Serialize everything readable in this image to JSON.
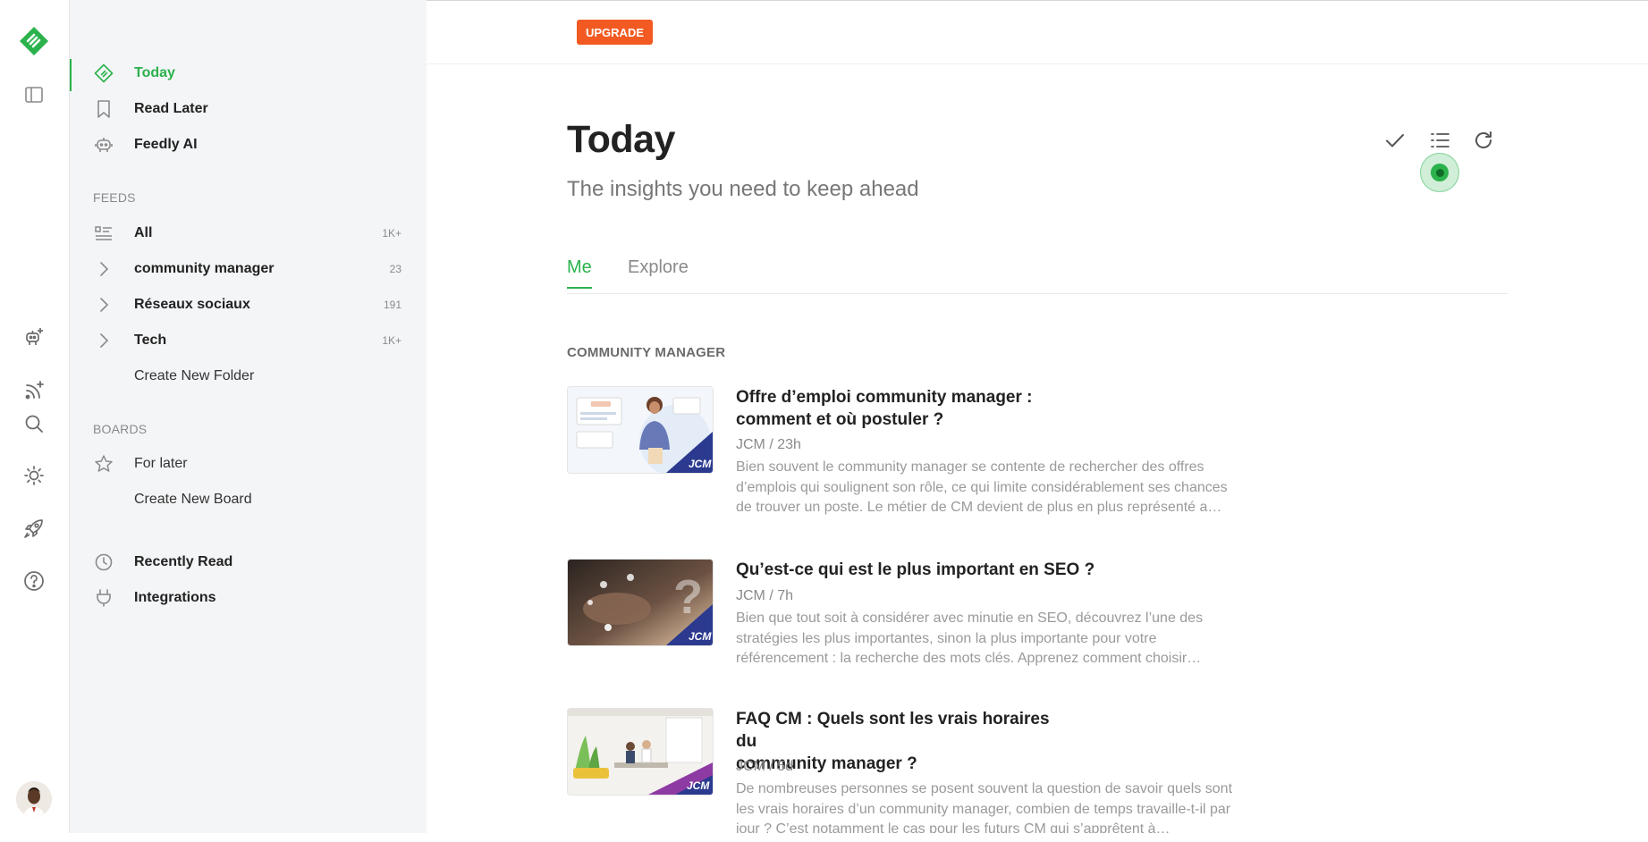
{
  "top_bar": {
    "upgrade_label": "UPGRADE"
  },
  "rail": {
    "icons": [
      "feedly-logo",
      "sidebar-toggle-icon",
      "add-ai-feed-icon",
      "add-rss-feed-icon",
      "search-icon",
      "theme-sun-icon",
      "rocket-icon",
      "help-icon",
      "user-avatar"
    ]
  },
  "sidebar": {
    "primary": [
      {
        "label": "Today",
        "icon": "today-icon",
        "active": true
      },
      {
        "label": "Read Later",
        "icon": "bookmark-icon"
      },
      {
        "label": "Feedly AI",
        "icon": "robot-icon"
      }
    ],
    "feeds_title": "FEEDS",
    "feeds": [
      {
        "label": "All",
        "count": "1K+",
        "icon": "list-icon"
      },
      {
        "label": "community manager",
        "count": "23",
        "icon": "chevron-right-icon"
      },
      {
        "label": "Réseaux sociaux",
        "count": "191",
        "icon": "chevron-right-icon"
      },
      {
        "label": "Tech",
        "count": "1K+",
        "icon": "chevron-right-icon"
      }
    ],
    "create_folder": "Create New Folder",
    "boards_title": "BOARDS",
    "boards": [
      {
        "label": "For later",
        "icon": "star-icon"
      }
    ],
    "create_board": "Create New Board",
    "bottom": [
      {
        "label": "Recently Read",
        "icon": "clock-icon"
      },
      {
        "label": "Integrations",
        "icon": "plug-icon"
      }
    ]
  },
  "main": {
    "title": "Today",
    "subtitle": "The insights you need to keep ahead",
    "tools": [
      "check-icon",
      "list-view-icon",
      "refresh-icon"
    ],
    "tabs": [
      {
        "label": "Me",
        "active": true
      },
      {
        "label": "Explore"
      }
    ],
    "group_title": "COMMUNITY MANAGER",
    "articles": [
      {
        "title_line1": "Offre d’emploi community manager :",
        "title_line2": "comment et où postuler ?",
        "meta": "JCM / 23h",
        "summary": "Bien souvent le community manager se contente de rechercher des offres d’emplois qui soulignent son rôle, ce qui limite considérablement ses chances de trouver un poste. Le métier de CM devient de plus en plus représenté a…",
        "thumb_badge": "JCM"
      },
      {
        "title_line1": "Qu’est-ce qui est le plus important en SEO ?",
        "title_line2": "",
        "meta": "JCM / 7h",
        "summary": "Bien que tout soit à considérer avec minutie en SEO, découvrez l’une des stratégies les plus importantes, sinon la plus importante pour votre référencement : la recherche des mots clés. Apprenez comment choisir…",
        "thumb_badge": "JCM"
      },
      {
        "title_line1": "FAQ CM : Quels sont les vrais horaires du",
        "title_line2": "community manager ?",
        "meta": "JCM / 5d",
        "summary": "De nombreuses personnes se posent souvent la question de savoir quels sont les vrais horaires d’un community manager, combien de temps travaille-t-il par jour ? C’est notamment le cas pour les futurs CM qui s’apprêtent à…",
        "thumb_badge": "JCM"
      }
    ]
  },
  "colors": {
    "accent": "#2bb24c",
    "upgrade": "#f25a22",
    "sidebar_bg": "#f4f5f7"
  }
}
